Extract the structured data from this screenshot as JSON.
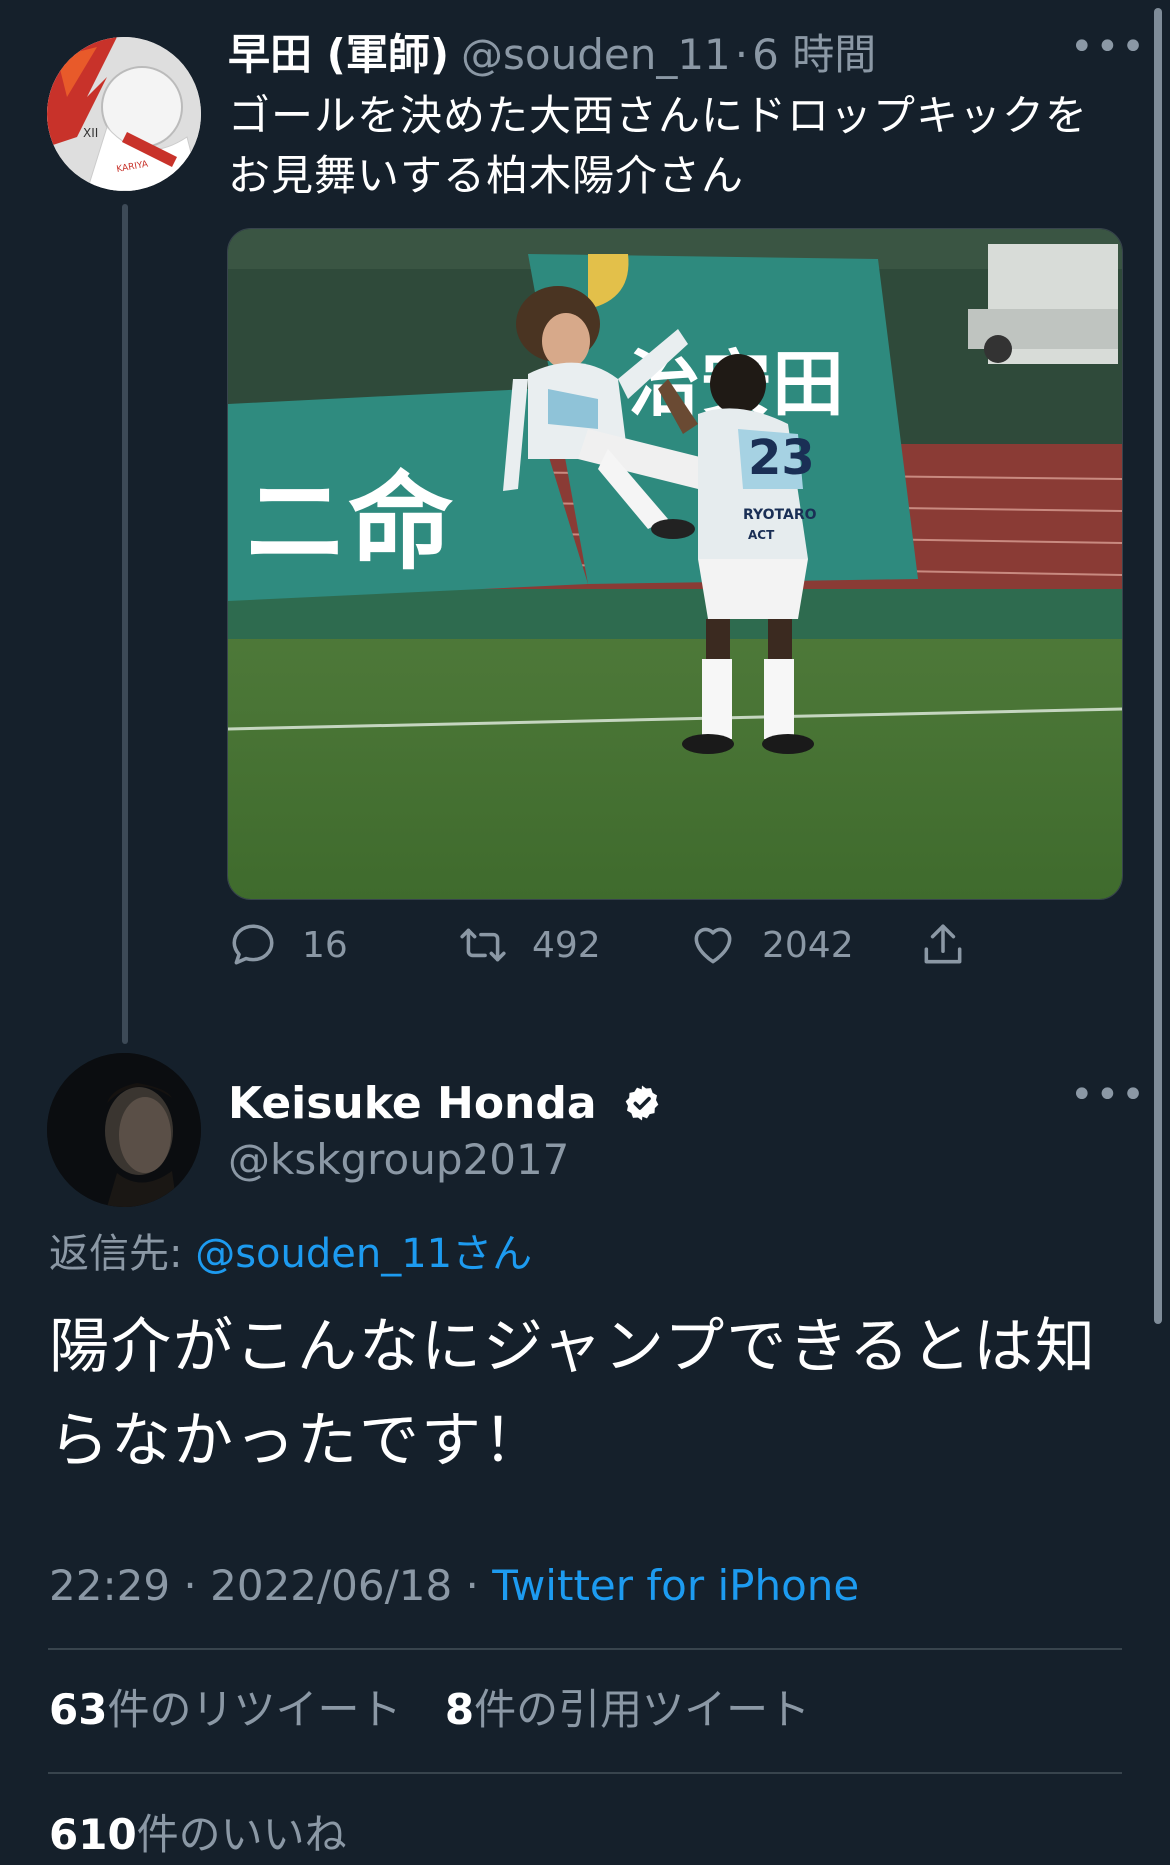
{
  "parent": {
    "display_name": "早田 (軍師)",
    "handle": "@souden_11",
    "sep": "·",
    "time": "6 時間",
    "text": "ゴールを決めた大西さんにドロップキックをお見舞いする柏木陽介さん",
    "media": {
      "banner_left": "ニ命",
      "banner_right": "治安田",
      "jersey_number": "23",
      "jersey_name": "RYOTARO",
      "jersey_sub": "ACT"
    },
    "actions": {
      "replies": "16",
      "retweets": "492",
      "likes": "2042"
    }
  },
  "main": {
    "display_name": "Keisuke Honda",
    "handle": "@kskgroup2017",
    "reply_prefix": "返信先:",
    "reply_handle": "@souden_11",
    "reply_suffix": "さん",
    "text": "陽介がこんなにジャンプできるとは知らなかったです！",
    "time": "22:29",
    "date": "2022/06/18",
    "source": "Twitter for iPhone",
    "retweets_count": "63",
    "retweets_label": "件のリツイート",
    "quotes_count": "8",
    "quotes_label": "件の引用ツイート",
    "likes_count": "610",
    "likes_label": "件のいいね"
  },
  "colors": {
    "background": "#15202b",
    "muted": "#8b98a5",
    "link": "#1d9bf0",
    "divider": "#38444d"
  }
}
